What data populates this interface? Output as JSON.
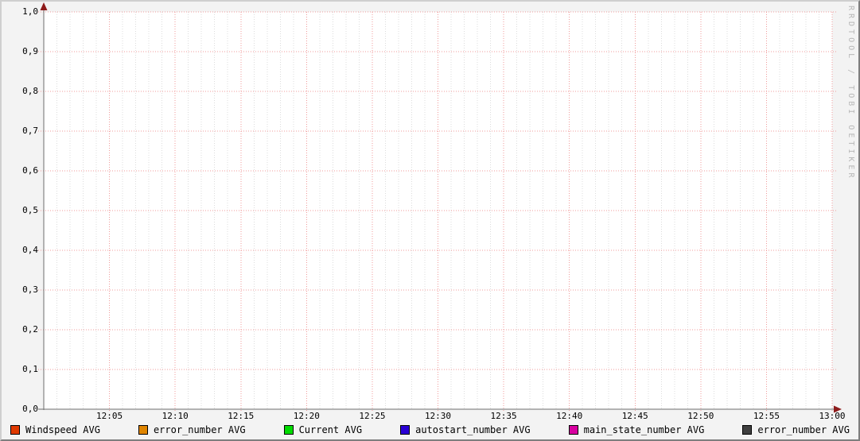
{
  "watermark": "RRDTOOL / TOBI OETIKER",
  "colors": {
    "background": "#F3F3F3",
    "canvas": "#FFFFFF",
    "grid_minor": "#DCDCDC",
    "grid_major": "#F09B9B",
    "axis": "#6E6E6E",
    "arrow": "#8E1B1B",
    "text": "#000000",
    "watermark": "#B8B8B8",
    "border_light": "#CFCFCF",
    "border_dark": "#7E7E7E",
    "swatch_border": "#000000"
  },
  "chart_data": {
    "type": "line",
    "title": "",
    "xlabel": "",
    "ylabel": "",
    "ylim": [
      0.0,
      1.0
    ],
    "y_tick_step": 0.1,
    "y_tick_labels": [
      "0,0",
      "0,1",
      "0,2",
      "0,3",
      "0,4",
      "0,5",
      "0,6",
      "0,7",
      "0,8",
      "0,9",
      "1,0"
    ],
    "x_tick_labels": [
      "12:05",
      "12:10",
      "12:15",
      "12:20",
      "12:25",
      "12:30",
      "12:35",
      "12:40",
      "12:45",
      "12:50",
      "12:55",
      "13:00"
    ],
    "x_minor_per_major": 5,
    "grid": true,
    "legend_position": "bottom",
    "series": [
      {
        "name": "Windspeed AVG",
        "color": "#E03A00",
        "values": []
      },
      {
        "name": "error_number AVG",
        "color": "#E08500",
        "values": []
      },
      {
        "name": "Current AVG",
        "color": "#00DB00",
        "values": []
      },
      {
        "name": "autostart_number AVG",
        "color": "#2A00D5",
        "values": []
      },
      {
        "name": "main_state_number AVG",
        "color": "#D800A0",
        "values": []
      },
      {
        "name": "error_number AVG",
        "color": "#3F3F3F",
        "values": []
      }
    ]
  }
}
